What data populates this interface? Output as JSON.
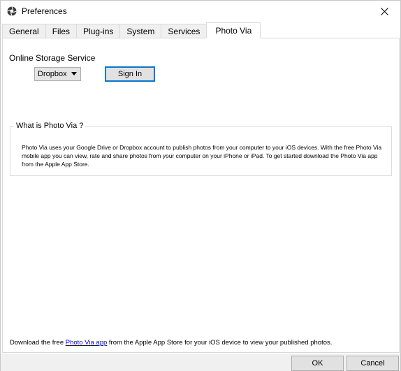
{
  "window": {
    "title": "Preferences",
    "app_icon": "aperture-icon",
    "close_icon": "close-icon"
  },
  "tabs": [
    {
      "label": "General",
      "active": false
    },
    {
      "label": "Files",
      "active": false
    },
    {
      "label": "Plug-ins",
      "active": false
    },
    {
      "label": "System",
      "active": false
    },
    {
      "label": "Services",
      "active": false
    },
    {
      "label": "Photo Via",
      "active": true
    }
  ],
  "photo_via": {
    "service_label": "Online Storage Service",
    "service_select_value": "Dropbox",
    "sign_in_label": "Sign In",
    "group_title": "What is Photo Via ?",
    "group_description": "Photo Via uses your Google Drive or Dropbox account to publish photos from your computer to your iOS devices. With the free Photo Via mobile app you can view, rate and share photos from your computer on your iPhone or iPad. To get started download the Photo Via app from the Apple App Store.",
    "footer_prefix": "Download the free ",
    "footer_link": "Photo Via app",
    "footer_suffix": " from the Apple App Store for your iOS device to view your published photos."
  },
  "buttons": {
    "ok": "OK",
    "cancel": "Cancel"
  },
  "colors": {
    "focus_border": "#0078d7",
    "link": "#0000ee",
    "tab_inactive_bg": "#f0f0f0"
  }
}
